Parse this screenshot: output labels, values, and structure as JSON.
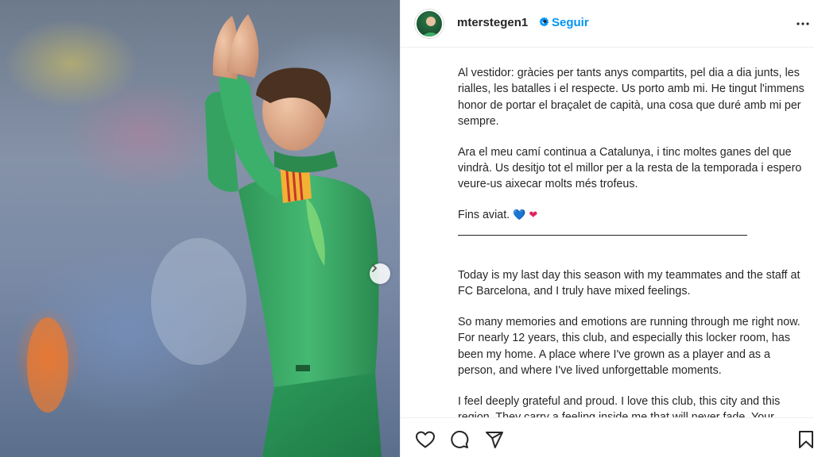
{
  "post": {
    "author": {
      "username": "mterstegen1",
      "verified": true,
      "follow_label": "Seguir",
      "separator": "•"
    },
    "caption": {
      "paragraphs": [
        "Al vestidor: gràcies per tants anys compartits, pel dia a dia junts, les rialles, les batalles i el respecte. Us porto amb mi. He tingut l'immens honor de portar el braçalet de capità, una cosa que duré amb mi per sempre.",
        "Ara el meu camí continua a Catalunya, i tinc moltes ganes del que vindrà. Us desitjo tot el millor per a la resta de la temporada i espero veure-us aixecar molts més trofeus.",
        "Fins aviat.",
        "Today is my last day this season with my teammates and the staff at FC Barcelona, and I truly have mixed feelings.",
        "So many memories and emotions are running through me right now. For nearly 12 years, this club, and especially this locker room, has been my home. A place where I've grown as a player and as a person, and where I've lived unforgettable moments.",
        "I feel deeply grateful and proud. I love this club, this city and this region. They carry a feeling inside me that will never fade. Your"
      ],
      "emoji_blue_heart": "💙",
      "emoji_red_heart": "❤"
    },
    "icons": {
      "like": "heart-outline-icon",
      "comment": "comment-bubble-icon",
      "share": "paper-plane-icon",
      "save": "bookmark-icon",
      "more": "more-options-icon",
      "next": "chevron-right-icon",
      "verified": "verified-badge-icon"
    },
    "colors": {
      "follow": "#0095f6",
      "verified": "#0095f6",
      "text": "#262626",
      "jersey": "#3fae6a",
      "captain_band": "#f2b134"
    }
  }
}
